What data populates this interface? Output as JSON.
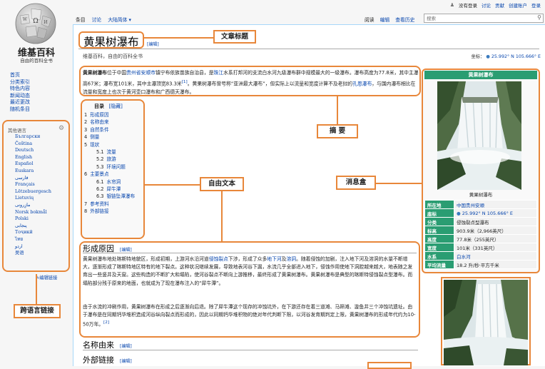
{
  "personal_tools": {
    "not_logged_in": "没有登录",
    "talk": "讨论",
    "contributions": "贡献",
    "create_account": "创建账户",
    "login": "登录"
  },
  "logo": {
    "name": "维基百科",
    "tagline": "自由的百科全书"
  },
  "nav": [
    "首页",
    "分类索引",
    "特色内容",
    "新闻动态",
    "最近更改",
    "随机条目"
  ],
  "languages": {
    "header": "其他语言",
    "items": [
      "Български",
      "Čeština",
      "Deutsch",
      "English",
      "Español",
      "Euskara",
      "فارسی",
      "Français",
      "Lëtzebuergesch",
      "Lietuvių",
      "مازِرونی",
      "Norsk bokmål",
      "Polski",
      "پنجابی",
      "Тоҷикӣ",
      "ไทย",
      "اردو",
      "吴语"
    ],
    "edit_links": "编辑链接"
  },
  "tabs_left": [
    "条目",
    "讨论",
    "大陆简体 ▾"
  ],
  "tabs_right": [
    "阅读",
    "编辑",
    "查看历史"
  ],
  "search": {
    "placeholder": "搜索"
  },
  "article": {
    "title": "黄果树瀑布",
    "title_edit": "[编辑]",
    "subtitle": "维基百科，自由的百科全书",
    "coord_label": "坐标：",
    "coord_value": "25.992° N 105.666° E",
    "lead_1": "黄果树瀑布",
    "lead_2": "位于中国",
    "lead_3": "贵州省安顺市",
    "lead_4": "镇宁布依族苗族自治县，是",
    "lead_5": "珠江",
    "lead_6": "水系打邦河的支流白水河九级瀑布群中规模最大的一级瀑布。瀑布高度为77.8米，其中主瀑高67米；瀑布宽101米，其中主瀑顶宽83.3米",
    "lead_ref": "[1]",
    "lead_7": "。黄果树瀑布曾号称“亚洲最大瀑布”，但实际上以流量和宽度计算不及老挝的",
    "lead_8": "孔恩瀑布",
    "lead_9": "，与国内瀑布相比在流量和宽度上也次于黄河壶口瀑布和广西德天瀑布。"
  },
  "toc": {
    "title": "目录",
    "hide": "[隐藏]",
    "items": [
      {
        "num": "1",
        "text": "形成原因",
        "level": 1
      },
      {
        "num": "2",
        "text": "名称由来",
        "level": 1
      },
      {
        "num": "3",
        "text": "自然条件",
        "level": 1
      },
      {
        "num": "4",
        "text": "侧量",
        "level": 1
      },
      {
        "num": "5",
        "text": "现状",
        "level": 1
      },
      {
        "num": "5.1",
        "text": "流量",
        "level": 2
      },
      {
        "num": "5.2",
        "text": "旅游",
        "level": 2
      },
      {
        "num": "5.3",
        "text": "环境问题",
        "level": 2
      },
      {
        "num": "6",
        "text": "主要景点",
        "level": 1
      },
      {
        "num": "6.1",
        "text": "水帘洞",
        "level": 2
      },
      {
        "num": "6.2",
        "text": "犀牛潭",
        "level": 2
      },
      {
        "num": "6.3",
        "text": "银链坠潭瀑布",
        "level": 2
      },
      {
        "num": "7",
        "text": "参考资料",
        "level": 1
      },
      {
        "num": "8",
        "text": "外部链接",
        "level": 1
      }
    ]
  },
  "sections": {
    "formation": {
      "heading": "形成原因",
      "edit": "[编辑]",
      "p1a": "黄果树瀑布地处喀斯特地貌区，形成初期，上游河水沿河道",
      "p1b": "侵蚀裂点",
      "p1c": "下涉，形成了众多",
      "p1d": "地下河",
      "p1e": "及",
      "p1f": "溶洞",
      "p1g": "。随着侵蚀的加剧，注入地下河及溶洞的水量不断增大，逐渐形成了喀斯特地区特有的地下裂点。这种状况继续发展，导致地表河谷下漏，水流几乎全部进入地下，侵蚀作用使地下洞腔越来越大，地表随之发育出一些竖井及天窗。这些构造的不断扩大和塌陷，使河谷裂点不断向上游推移，最终形成了黄果树瀑布。黄果树瀑布是典型的喀斯特侵蚀裂点型瀑布。而塌陷部分残于原来的地面，也就成为了现在瀑布注入的“犀牛潭”。",
      "p2a": "由于水流的冲刷作用，黄果树瀑布在形成之后逐渐向后退。除了犀牛潭这个现存的冲蚀坑外，在下游还存在着三道滩、马蹄滩、漩鱼井三个冲蚀坑遗址。由于瀑布是在同期钙华堆积造成河谷纵向裂点而形成的，因此以同期钙华堆积物的绝对年代判断下限，以河谷发育期判定上限，黄果树瀑布的形成年代约为10-50万年。",
      "p2ref": "[2]"
    },
    "name_origin": {
      "heading": "名称由来",
      "edit": "[编辑]"
    },
    "external": {
      "heading": "外部链接",
      "edit": "[编辑]"
    }
  },
  "infobox": {
    "title": "黄果树瀑布",
    "caption": "黄果树瀑布",
    "rows": [
      {
        "k": "所在地",
        "v": "中国贵州安顺",
        "link": true
      },
      {
        "k": "座标",
        "v": "25.992° N 105.666° E",
        "link": true
      },
      {
        "k": "分类",
        "v": "侵蚀裂点型瀑布",
        "link": false
      },
      {
        "k": "标高",
        "v": "903.9米（2,966英尺）",
        "link": false
      },
      {
        "k": "高度",
        "v": "77.8米（255英尺）",
        "link": false
      },
      {
        "k": "宽度",
        "v": "101米（331英尺）",
        "link": false
      },
      {
        "k": "水系",
        "v": "白水河",
        "link": true
      },
      {
        "k": "平均流量",
        "v": "18.2 升/秒·平方千米",
        "link": false
      }
    ]
  },
  "callouts": {
    "title": "文章标题",
    "summary": "摘 要",
    "free_text": "自由文本",
    "infobox": "消息盒",
    "interlanguage": "跨语言链接"
  },
  "colors": {
    "annotation": "#e8873a",
    "infobox_header": "#2a9d72",
    "link": "#0645ad"
  }
}
